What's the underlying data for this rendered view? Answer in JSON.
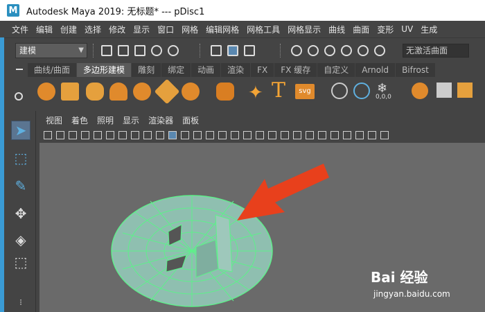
{
  "window": {
    "logo": "M",
    "title": "Autodesk Maya 2019: 无标题*   ---   pDisc1"
  },
  "menu": {
    "items": [
      "文件",
      "编辑",
      "创建",
      "选择",
      "修改",
      "显示",
      "窗口",
      "网格",
      "编辑网格",
      "网格工具",
      "网格显示",
      "曲线",
      "曲面",
      "变形",
      "UV",
      "生成"
    ]
  },
  "statusline": {
    "mode": "建模",
    "surface_field": "无激活曲面"
  },
  "shelf": {
    "tabs": [
      {
        "label": "曲线/曲面",
        "active": false
      },
      {
        "label": "多边形建模",
        "active": true
      },
      {
        "label": "雕刻",
        "active": false
      },
      {
        "label": "绑定",
        "active": false
      },
      {
        "label": "动画",
        "active": false
      },
      {
        "label": "渲染",
        "active": false
      },
      {
        "label": "FX",
        "active": false
      },
      {
        "label": "FX 缓存",
        "active": false
      },
      {
        "label": "自定义",
        "active": false
      },
      {
        "label": "Arnold",
        "active": false
      },
      {
        "label": "Bifrost",
        "active": false
      }
    ],
    "text_tool": "T",
    "svg_tool": "svg",
    "counter_tool": "0,0,0"
  },
  "viewport_panel": {
    "menu": [
      "视图",
      "着色",
      "照明",
      "显示",
      "渲染器",
      "面板"
    ]
  },
  "watermark": {
    "main": "Bai 经验",
    "url": "jingyan.baidu.com"
  },
  "colors": {
    "mesh_fill": "#8fbfb0",
    "mesh_wire": "#5ef08a",
    "arrow": "#e8401c",
    "viewport_bg": "#6a6a6a"
  }
}
